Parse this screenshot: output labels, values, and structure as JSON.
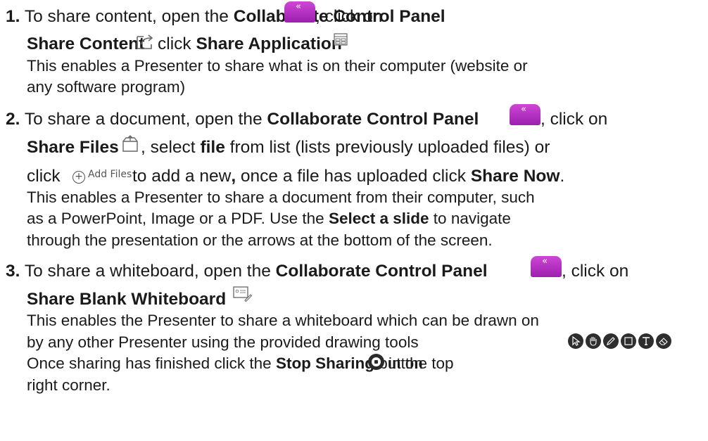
{
  "steps": [
    {
      "number": "1.",
      "line1_pre": "To share content, open the ",
      "line1_bold": "Collaborate Control Panel",
      "line1_post": ", click on",
      "line2_bold_a": "Share Content",
      "line2_mid": " click ",
      "line2_bold_b": "Share Application",
      "desc": [
        "This enables a Presenter to share what is on their computer (website or",
        "any software program)"
      ]
    },
    {
      "number": "2.",
      "line1_pre": "To share a document, open the ",
      "line1_bold": "Collaborate Control Panel",
      "line1_post": ", click on",
      "line2_bold_a": "Share Files",
      "line2_mid": " , select ",
      "line2_bold_b": "file",
      "line2_post": " from list (lists previously uploaded files) or",
      "line3_pre": "click ",
      "add_files_label": "Add Files",
      "line3_mid": " to add a new",
      "line3_comma": ",",
      "line3_post": " once a file has uploaded click ",
      "line3_bold": "Share Now",
      "line3_end": ".",
      "desc_a": "This enables a Presenter to share a document from their computer, such",
      "desc_b": "as a PowerPoint, Image or a PDF. Use the ",
      "desc_b_bold": "Select a slide",
      "desc_b_post": " to navigate",
      "desc_c": "through the presentation or the arrows at the bottom of the screen."
    },
    {
      "number": "3.",
      "line1_pre": "To share a whiteboard, open the ",
      "line1_bold": "Collaborate Control Panel",
      "line1_post": ", click on",
      "line2_bold": "Share Blank Whiteboard",
      "desc_a": "This enables the Presenter to share a whiteboard which can be drawn on",
      "desc_b": "by any other Presenter using the provided drawing tools",
      "desc_c_pre": "Once sharing has finished click the ",
      "desc_c_bold": "Stop Sharing",
      "desc_c_mid": " button",
      "desc_c_post": " in the top",
      "desc_d": "right corner."
    }
  ],
  "icons": {
    "control_panel": "collaborate-control-panel-icon",
    "share_content": "share-content-icon",
    "share_application": "share-application-icon",
    "share_files": "share-files-icon",
    "add_files": "add-files-icon",
    "whiteboard": "whiteboard-icon",
    "drawing_tools": [
      "select-tool-icon",
      "pan-tool-icon",
      "pen-tool-icon",
      "shape-tool-icon",
      "text-tool-icon",
      "eraser-tool-icon"
    ],
    "stop_sharing": "stop-sharing-icon"
  },
  "colors": {
    "control_panel_purple": "#b230c2",
    "tool_dark": "#2e2e2e"
  }
}
